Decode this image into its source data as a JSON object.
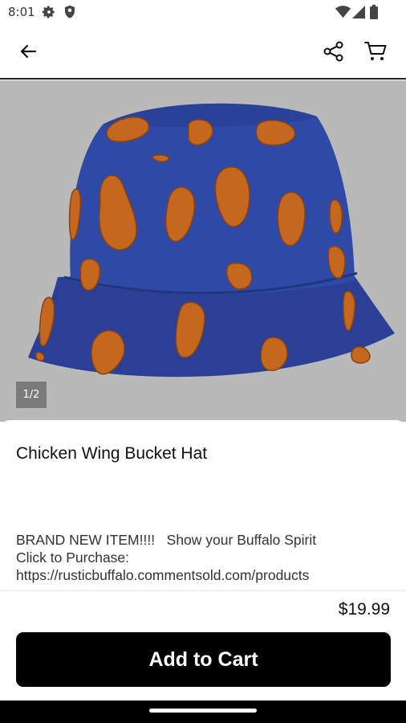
{
  "status_bar": {
    "time": "8:01",
    "icons": [
      "gear-icon",
      "shield-icon",
      "wifi-icon",
      "signal-icon",
      "battery-icon"
    ]
  },
  "app_bar": {
    "icons": [
      "back-arrow-icon",
      "share-icon",
      "cart-icon"
    ]
  },
  "product": {
    "image_counter": "1/2",
    "title": "Chicken Wing Bucket Hat",
    "description_lines": [
      "BRAND NEW ITEM!!!!   Show your Buffalo Spirit",
      "Click to Purchase:",
      "https://rusticbuffalo.commentsold.com/products"
    ],
    "price": "$19.99",
    "add_to_cart_label": "Add to Cart"
  },
  "colors": {
    "image_background": "#b9b9b9",
    "hat_blue": "#2f49a6",
    "wing_orange": "#c86a22",
    "button": "#000000"
  }
}
